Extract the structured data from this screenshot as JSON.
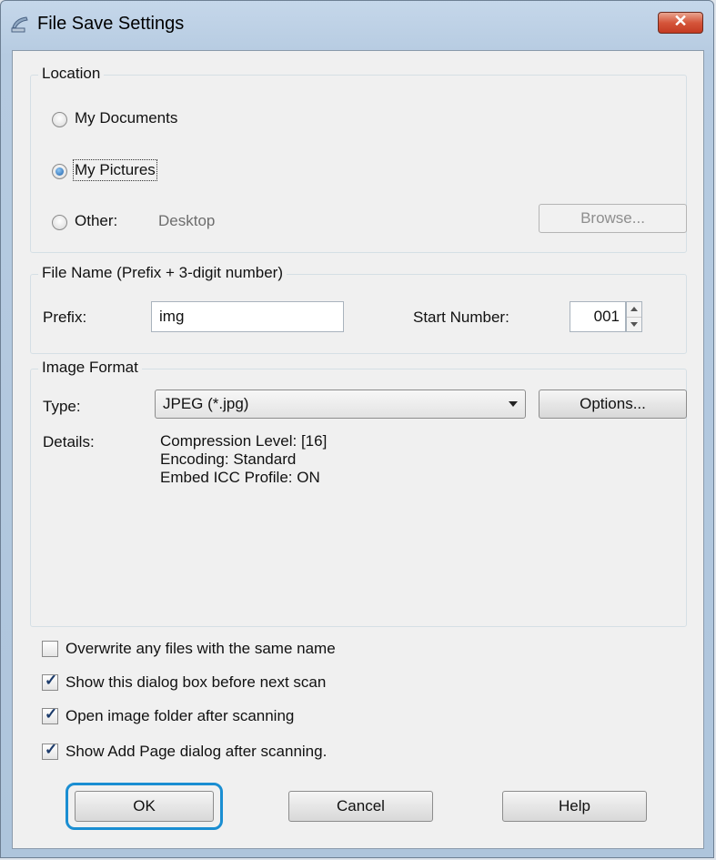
{
  "window": {
    "title": "File Save Settings"
  },
  "location": {
    "legend": "Location",
    "options": [
      "My Documents",
      "My Pictures",
      "Other:"
    ],
    "other_value": "Desktop",
    "browse_label": "Browse..."
  },
  "file_name": {
    "legend": "File Name (Prefix + 3-digit number)",
    "prefix_label": "Prefix:",
    "prefix_value": "img",
    "start_number_label": "Start Number:",
    "start_number_value": "001"
  },
  "image_format": {
    "legend": "Image Format",
    "type_label": "Type:",
    "type_value": "JPEG (*.jpg)",
    "options_label": "Options...",
    "details_label": "Details:",
    "details_lines": [
      "Compression Level: [16]",
      "Encoding: Standard",
      "Embed ICC Profile: ON"
    ]
  },
  "checkboxes": [
    {
      "label": "Overwrite any files with the same name",
      "checked": false
    },
    {
      "label": "Show this dialog box before next scan",
      "checked": true
    },
    {
      "label": "Open image folder after scanning",
      "checked": true
    },
    {
      "label": "Show Add Page dialog after scanning.",
      "checked": true
    }
  ],
  "buttons": {
    "ok": "OK",
    "cancel": "Cancel",
    "help": "Help"
  },
  "colors": {
    "focus_ring": "#1a8ed2",
    "close_button": "#d5553a"
  }
}
